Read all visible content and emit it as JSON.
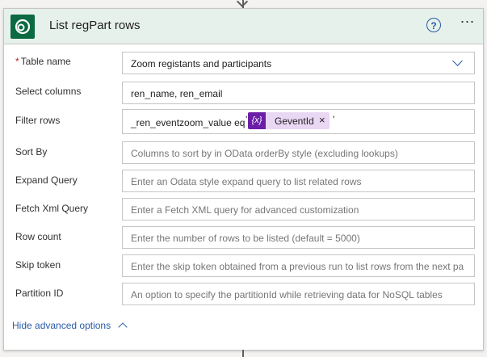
{
  "card": {
    "title": "List regPart rows",
    "help_icon": "question-circle-icon",
    "more_icon": "ellipsis-icon",
    "accent": "#0b6a41",
    "header_bg": "#e6f1eb"
  },
  "fields": {
    "table_name": {
      "label": "Table name",
      "required_mark": "*",
      "value": "Zoom registants and participants"
    },
    "select_columns": {
      "label": "Select columns",
      "value": "ren_name, ren_email"
    },
    "filter_rows": {
      "label": "Filter rows",
      "value_prefix": "_ren_eventzoom_value eq",
      "quote": "'",
      "token_icon": "{x}",
      "token_label": "GeventId",
      "token_remove": "×"
    },
    "sort_by": {
      "label": "Sort By",
      "placeholder": "Columns to sort by in OData orderBy style (excluding lookups)"
    },
    "expand_query": {
      "label": "Expand Query",
      "placeholder": "Enter an Odata style expand query to list related rows"
    },
    "fetch_xml": {
      "label": "Fetch Xml Query",
      "placeholder": "Enter a Fetch XML query for advanced customization"
    },
    "row_count": {
      "label": "Row count",
      "placeholder": "Enter the number of rows to be listed (default = 5000)"
    },
    "skip_token": {
      "label": "Skip token",
      "placeholder": "Enter the skip token obtained from a previous run to list rows from the next pa"
    },
    "partition_id": {
      "label": "Partition ID",
      "placeholder": "An option to specify the partitionId while retrieving data for NoSQL tables"
    }
  },
  "advanced_options": {
    "label": "Hide advanced options"
  }
}
